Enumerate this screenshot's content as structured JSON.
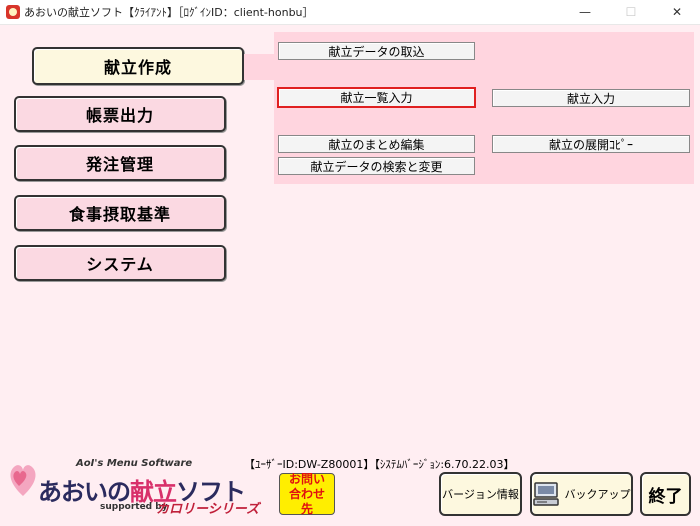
{
  "window": {
    "title": "あおいの献立ソフト【ｸﾗｲｱﾝﾄ】［ﾛｸﾞｲﾝID：client-honbu］",
    "minimize": "—",
    "maximize": "☐",
    "close": "✕"
  },
  "main_menu": [
    {
      "label": "献立作成",
      "active": true
    },
    {
      "label": "帳票出力",
      "active": false
    },
    {
      "label": "発注管理",
      "active": false
    },
    {
      "label": "食事摂取基準",
      "active": false
    },
    {
      "label": "システム",
      "active": false
    }
  ],
  "submenu": {
    "import": "献立データの取込",
    "list_input": "献立一覧入力",
    "input": "献立入力",
    "bulk_edit": "献立のまとめ編集",
    "expand_copy": "献立の展開ｺﾋﾟｰ",
    "search_change": "献立データの検索と変更"
  },
  "footer": {
    "user_info": "【ﾕｰｻﾞｰID:DW-Z80001】【ｼｽﾃﾑﾊﾞｰｼﾞｮﾝ:6.70.22.03】",
    "contact_button": "お問い合わせ先",
    "version_button": "バージョン情報",
    "backup_button": "バックアップ",
    "exit_button": "終了"
  },
  "logo": {
    "tagline": "AoI's Menu Software",
    "name_prefix": "あおいの",
    "name_highlight": "献立",
    "name_suffix": "ソフト",
    "supported_by": "supported by",
    "brand": "カロリーシリーズ"
  },
  "colors": {
    "background": "#ffeef2",
    "submenu_panel": "#ffd5df",
    "menu_button": "#fbd9e2",
    "active_button": "#fdf8df",
    "selected_outline": "#e02020",
    "contact_button": "#ffee00"
  }
}
